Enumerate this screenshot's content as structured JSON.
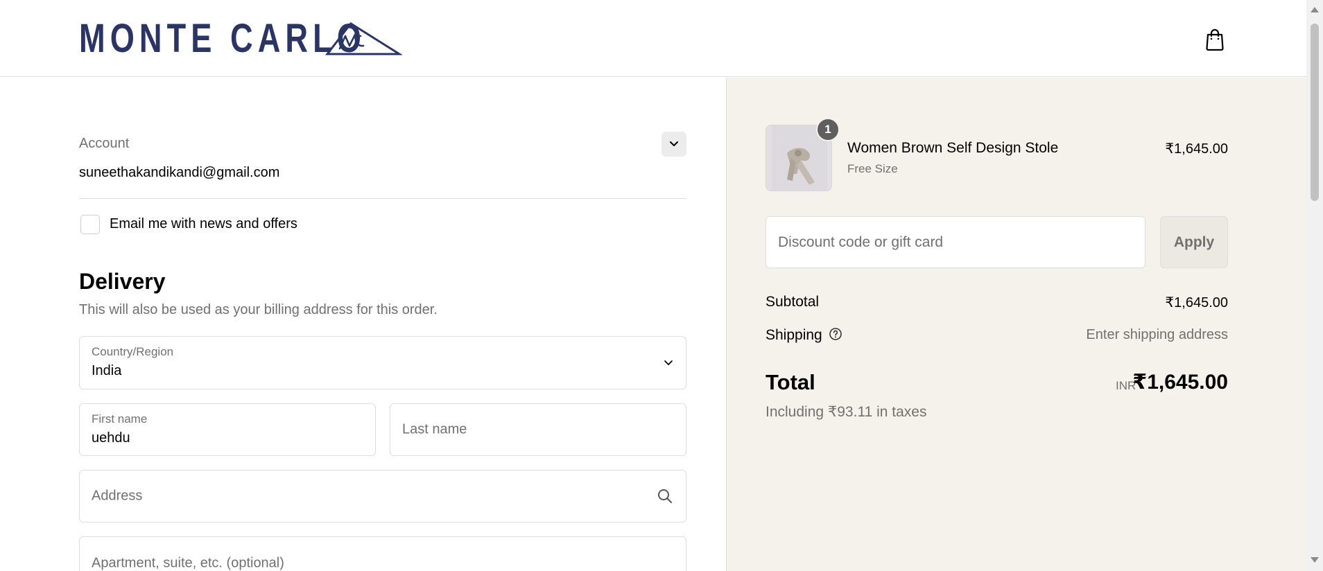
{
  "header": {
    "logo_text": "MONTE CARLO",
    "cart_icon": "shopping-bag-icon"
  },
  "account": {
    "label": "Account",
    "email": "suneethakandikandi@gmail.com",
    "toggle_icon": "chevron-down-icon"
  },
  "newsletter": {
    "label": "Email me with news and offers",
    "checked": false
  },
  "delivery": {
    "title": "Delivery",
    "subtitle": "This will also be used as your billing address for this order.",
    "country": {
      "label": "Country/Region",
      "value": "India"
    },
    "first_name": {
      "label": "First name",
      "value": "uehdu"
    },
    "last_name": {
      "placeholder": "Last name"
    },
    "address": {
      "placeholder": "Address",
      "icon": "search-icon"
    },
    "apartment": {
      "placeholder": "Apartment, suite, etc. (optional)"
    }
  },
  "order": {
    "product": {
      "quantity": "1",
      "name": "Women Brown Self Design Stole",
      "variant": "Free Size",
      "price": "₹1,645.00"
    },
    "discount": {
      "placeholder": "Discount code or gift card",
      "apply_label": "Apply"
    },
    "subtotal": {
      "label": "Subtotal",
      "value": "₹1,645.00"
    },
    "shipping": {
      "label": "Shipping",
      "value": "Enter shipping address",
      "icon": "question-circle-icon"
    },
    "total": {
      "label": "Total",
      "currency": "INR",
      "value": "₹1,645.00"
    },
    "taxes": "Including ₹93.11 in taxes"
  },
  "colors": {
    "brand": "#2a3566",
    "sidebar_bg": "#f5f2ec",
    "border": "#dedede",
    "muted_text": "#707070"
  }
}
